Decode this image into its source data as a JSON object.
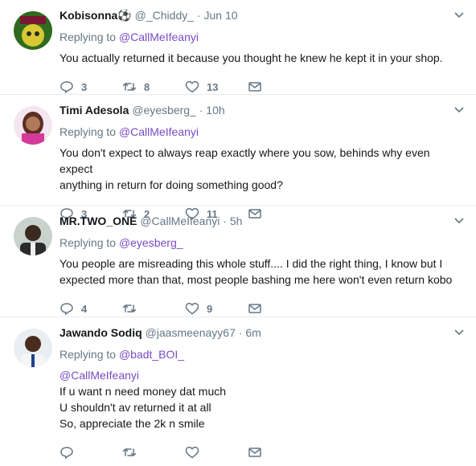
{
  "tweets": [
    {
      "name": "Kobisonna⚽",
      "handle": "@_Chiddy_",
      "dot": "·",
      "time": "Jun 10",
      "replying_label": "Replying to ",
      "replying_to": "@CallMeIfeanyi",
      "lines": [
        "You actually returned it because you thought he knew he kept it in your shop."
      ],
      "replies": "3",
      "retweets": "8",
      "likes": "13"
    },
    {
      "name": "Timi Adesola",
      "handle": "@eyesberg_",
      "dot": "·",
      "time": "10h",
      "replying_label": "Replying to ",
      "replying_to": "@CallMeIfeanyi",
      "lines": [
        "You don't expect to always reap exactly where you sow, behinds why even expect",
        "anything in return for doing something good?"
      ],
      "replies": "3",
      "retweets": "2",
      "likes": "11"
    },
    {
      "name": "MR.TWO_ONE",
      "handle": "@CallMeIfeanyi",
      "dot": "·",
      "time": "5h",
      "replying_label": "Replying to ",
      "replying_to": "@eyesberg_",
      "lines": [
        "You people are misreading this whole stuff.... I did the right thing, I know but I",
        "expected more than that, most people bashing me here won't even return kobo"
      ],
      "replies": "4",
      "retweets": "",
      "likes": "9"
    },
    {
      "name": "Jawando Sodiq",
      "handle": "@jaasmeenayy67",
      "dot": "·",
      "time": "6m",
      "replying_label": "Replying to ",
      "replying_to": "@badt_BOI_",
      "mention_line": "@CallMeIfeanyi",
      "lines": [
        "If u want n need money dat much",
        "U shouldn't av returned it at all",
        "So, appreciate the 2k n smile"
      ],
      "replies": "",
      "retweets": "",
      "likes": ""
    }
  ],
  "colors": {
    "link": "#794bc4",
    "meta": "#657786",
    "divider": "#e6ecf0"
  },
  "icons": [
    "chevron-down-icon",
    "reply-icon",
    "retweet-icon",
    "heart-icon",
    "envelope-icon"
  ]
}
